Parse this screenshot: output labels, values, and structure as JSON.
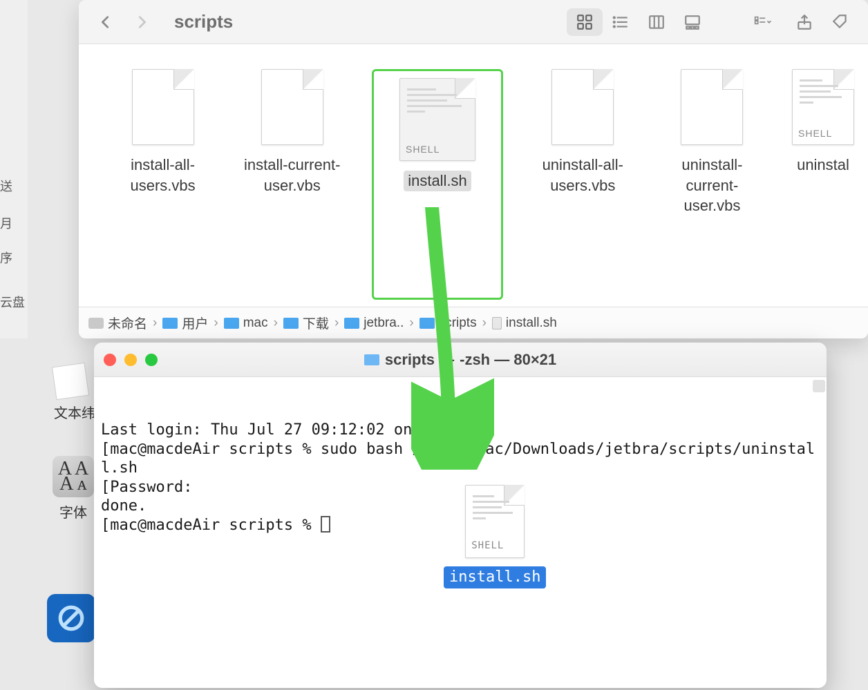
{
  "finder": {
    "title": "scripts",
    "files": [
      {
        "name": "install-all-users.vbs",
        "type": "blank"
      },
      {
        "name": "install-current-user.vbs",
        "type": "blank"
      },
      {
        "name": "install.sh",
        "type": "shell",
        "selected": true,
        "highlighted": true
      },
      {
        "name": "uninstall-all-users.vbs",
        "type": "blank"
      },
      {
        "name": "uninstall-current-user.vbs",
        "type": "blank"
      },
      {
        "name": "uninstal",
        "type": "shell"
      }
    ],
    "pathbar": [
      "未命名",
      "用户",
      "mac",
      "下载",
      "jetbra..",
      "scripts",
      "install.sh"
    ],
    "shell_badge": "SHELL"
  },
  "sidebar": {
    "items": [
      "送",
      "月",
      "序",
      "云盘"
    ]
  },
  "terminal": {
    "title_prefix": "scripts —",
    "title_suffix": "-zsh — 80×21",
    "lines": [
      "Last login: Thu Jul 27 09:12:02 on console",
      "[mac@macdeAir scripts % sudo bash /Users/mac/Downloads/jetbra/scripts/uninstall.sh",
      "[Password:",
      "done.",
      "[mac@macdeAir scripts % "
    ],
    "drag_file": "install.sh"
  },
  "desktop": {
    "textedit": "文本纬",
    "fontbook": "字体",
    "fontbook_aa": "A A\nA ᴀ"
  }
}
